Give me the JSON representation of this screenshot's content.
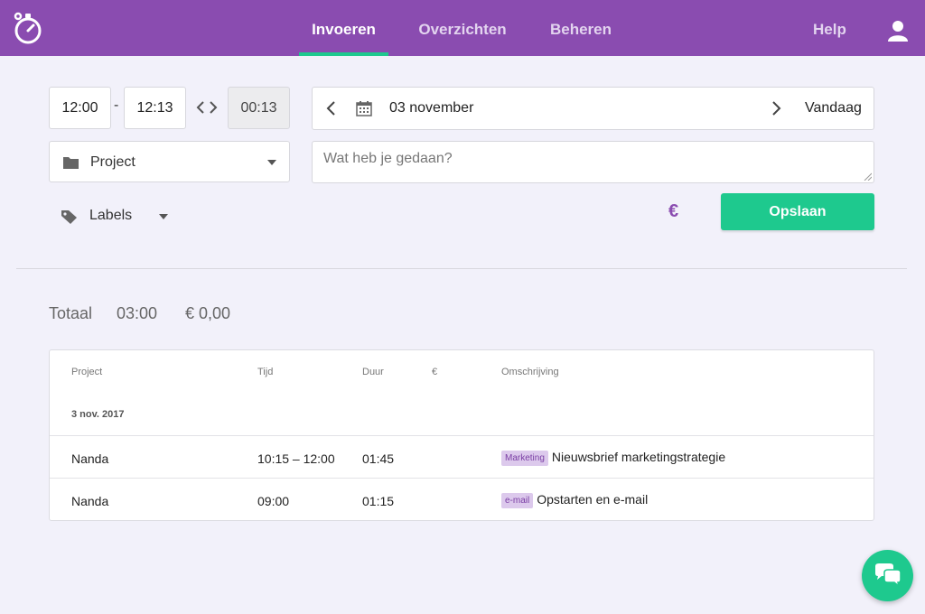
{
  "colors": {
    "brand": "#8a4cb0",
    "accent": "#1ec98e",
    "background": "#f2f1fa",
    "badge_bg": "#dcc9ec"
  },
  "header": {
    "logo_icon": "stopwatch-icon",
    "tabs": [
      {
        "label": "Invoeren",
        "active": true
      },
      {
        "label": "Overzichten",
        "active": false
      },
      {
        "label": "Beheren",
        "active": false
      }
    ],
    "help_label": "Help",
    "user_icon": "user-icon"
  },
  "entry_form": {
    "start_time": "12:00",
    "separator": "-",
    "end_time": "12:13",
    "duration": "00:13",
    "date": "03 november",
    "today_label": "Vandaag",
    "project_placeholder": "Project",
    "description_placeholder": "Wat heb je gedaan?",
    "labels_placeholder": "Labels",
    "billable_symbol": "€",
    "save_label": "Opslaan"
  },
  "totals": {
    "label": "Totaal",
    "duration": "03:00",
    "amount": "€ 0,00"
  },
  "table": {
    "columns": [
      "Project",
      "Tijd",
      "Duur",
      "€",
      "Omschrijving"
    ],
    "group_date": "3 nov. 2017",
    "rows": [
      {
        "project": "Nanda",
        "time": "10:15 – 12:00",
        "duration": "01:45",
        "amount": "",
        "label": "Marketing",
        "description": "Nieuwsbrief marketingstrategie"
      },
      {
        "project": "Nanda",
        "time": "09:00",
        "duration": "01:15",
        "amount": "",
        "label": "e-mail",
        "description": "Opstarten en e-mail"
      }
    ]
  },
  "chat_icon": "chat-bubbles-icon"
}
